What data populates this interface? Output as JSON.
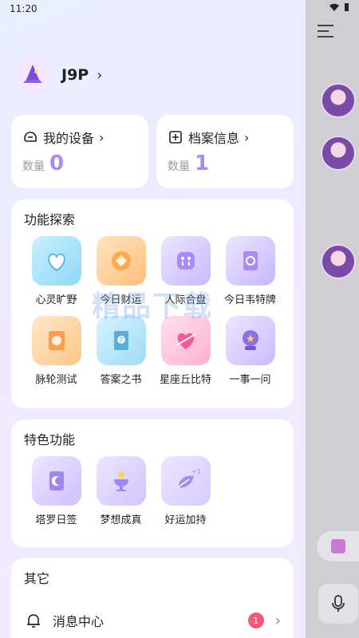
{
  "status": {
    "time": "11:20"
  },
  "profile": {
    "name": "J9P"
  },
  "devices": {
    "title": "我的设备",
    "count_label": "数量",
    "count": "0"
  },
  "archive": {
    "title": "档案信息",
    "count_label": "数量",
    "count": "1"
  },
  "explore": {
    "title": "功能探索",
    "items": [
      {
        "label": "心灵旷野",
        "icon": "heart-shield-icon"
      },
      {
        "label": "今日财运",
        "icon": "coin-icon"
      },
      {
        "label": "人际合盘",
        "icon": "people-icon"
      },
      {
        "label": "今日韦特牌",
        "icon": "tarot-card-icon"
      },
      {
        "label": "脉轮测试",
        "icon": "chakra-icon"
      },
      {
        "label": "答案之书",
        "icon": "answer-book-icon"
      },
      {
        "label": "星座丘比特",
        "icon": "cupid-heart-icon"
      },
      {
        "label": "一事一问",
        "icon": "crystal-ball-icon"
      }
    ]
  },
  "features": {
    "title": "特色功能",
    "items": [
      {
        "label": "塔罗日签",
        "icon": "moon-card-icon"
      },
      {
        "label": "梦想成真",
        "icon": "dream-cup-icon"
      },
      {
        "label": "好运加持",
        "icon": "leaf-plus-icon"
      }
    ]
  },
  "other": {
    "title": "其它",
    "message_center": "消息中心",
    "badge": "1"
  },
  "watermark": "精品下载",
  "colors": {
    "accent": "#a78bfa",
    "badge": "#f35a7a"
  }
}
